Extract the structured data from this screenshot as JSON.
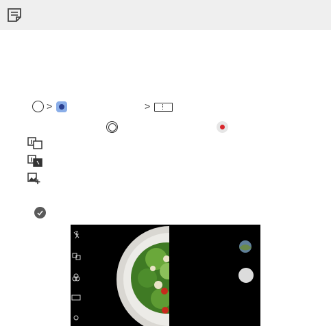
{
  "note_bar": {
    "icon": "note-icon"
  },
  "instruction": {
    "chevron": ">",
    "icons": [
      "home-circle-icon",
      "camera-app-icon",
      "split-frame-mode-icon",
      "shutter-icon",
      "record-icon"
    ]
  },
  "options": {
    "icons": [
      "grid-shot-1-icon",
      "grid-shot-2-icon",
      "add-image-icon"
    ]
  },
  "confirm": {
    "icon": "check-icon"
  },
  "camera_preview": {
    "side_icons": [
      "flash-off-icon",
      "mode-switch-icon",
      "filter-icon",
      "aspect-ratio-icon",
      "settings-icon"
    ],
    "thumbnail": "gallery-thumbnail",
    "shutter": "shutter-button"
  }
}
